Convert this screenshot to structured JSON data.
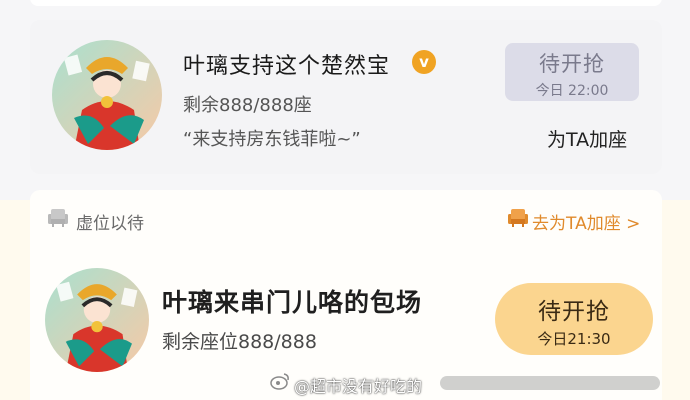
{
  "card1": {
    "name": "叶璃支持这个楚然宝",
    "badge": "v",
    "seats": "剩余888/888座",
    "quote": "“来支持房东钱菲啦~”",
    "button_title": "待开抢",
    "button_time": "今日 22:00",
    "add_seat": "为TA加座"
  },
  "vacant": {
    "label": "虚位以待",
    "link": "去为TA加座 >"
  },
  "card2": {
    "name": "叶璃来串门儿咯的包场",
    "seats": "剩余座位888/888",
    "button_title": "待开抢",
    "button_time": "今日21:30"
  },
  "watermark": {
    "text": "@超市没有好吃的"
  },
  "colors": {
    "accent_orange": "#e08a2c",
    "button_gray_bg": "#dcdce8",
    "button_orange_bg": "#fbd58f",
    "verified_badge": "#f0a323"
  }
}
